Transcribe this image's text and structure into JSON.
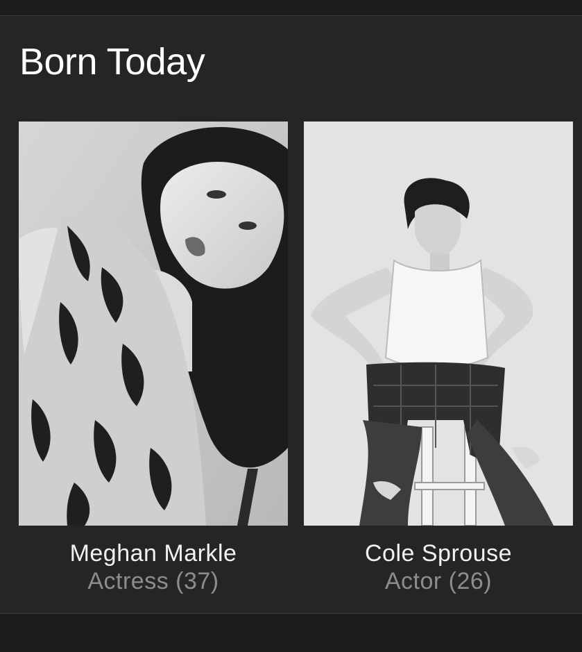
{
  "section": {
    "title": "Born Today"
  },
  "people": [
    {
      "name": "Meghan Markle",
      "role": "Actress (37)"
    },
    {
      "name": "Cole Sprouse",
      "role": "Actor (26)"
    }
  ],
  "colors": {
    "background": "#252525",
    "title_text": "#ffffff",
    "name_text": "#f2f2f2",
    "role_text": "#8d8d8d"
  }
}
